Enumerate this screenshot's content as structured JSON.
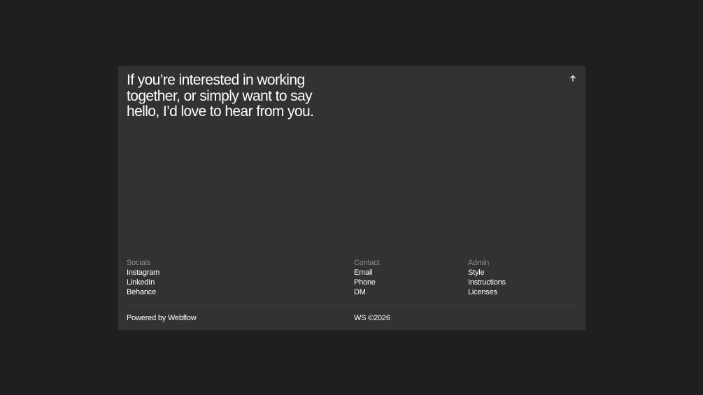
{
  "hero": {
    "headline": "If you’re interested in working together, or simply want to say hello, I’d love to hear from you."
  },
  "back_to_top": {
    "icon": "arrow-up-icon"
  },
  "socials": {
    "heading": "Socials",
    "links": [
      "Instagram",
      "LinkedIn",
      "Behance"
    ]
  },
  "contact": {
    "heading": "Contact",
    "links": [
      "Email",
      "Phone",
      "DM"
    ]
  },
  "admin": {
    "heading": "Admin",
    "links": [
      "Style",
      "Instructions",
      "Licenses"
    ]
  },
  "footer": {
    "powered_by": "Powered by Webflow",
    "copyright": "WS ©2026"
  },
  "colors": {
    "page_background": "#1f1f1f",
    "panel_background": "#323232",
    "heading_muted": "#8d8d8d",
    "text": "#ffffff"
  }
}
